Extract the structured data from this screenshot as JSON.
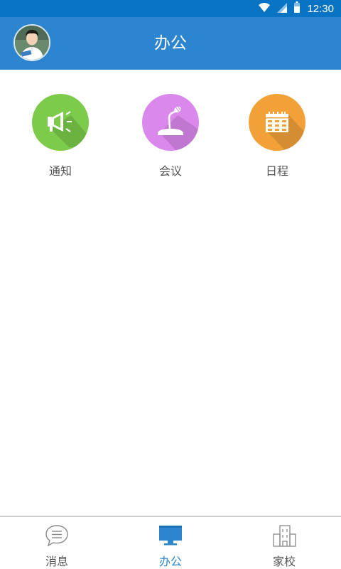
{
  "status_bar": {
    "time": "12:30",
    "icons": [
      "wifi-icon",
      "signal-icon",
      "battery-icon"
    ]
  },
  "header": {
    "title": "办公"
  },
  "functions": [
    {
      "label": "通知",
      "icon": "megaphone-icon",
      "color": "#7ccb4a"
    },
    {
      "label": "会议",
      "icon": "microphone-icon",
      "color": "#db88ed"
    },
    {
      "label": "日程",
      "icon": "calendar-icon",
      "color": "#f2a139"
    }
  ],
  "tabs": [
    {
      "label": "消息",
      "icon": "message-icon",
      "active": false
    },
    {
      "label": "办公",
      "icon": "monitor-icon",
      "active": true
    },
    {
      "label": "家校",
      "icon": "school-icon",
      "active": false
    }
  ],
  "colors": {
    "status_bar": "#0a74c4",
    "header": "#2d85cf",
    "accent": "#2d85cf"
  }
}
